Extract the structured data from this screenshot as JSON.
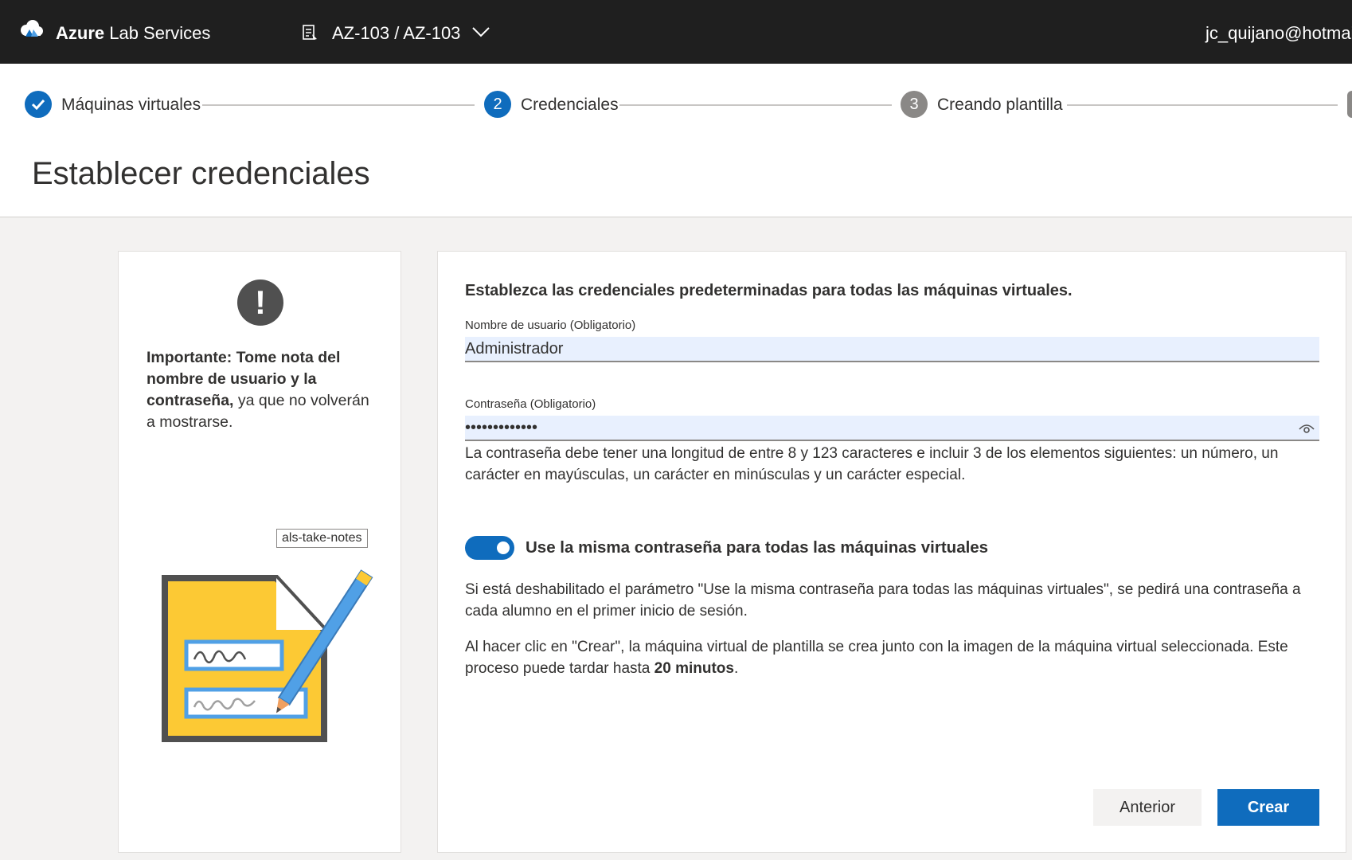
{
  "topbar": {
    "brand_bold": "Azure",
    "brand_rest": " Lab Services",
    "lab_name": "AZ-103 / AZ-103",
    "user_email": "jc_quijano@hotmai"
  },
  "steps": [
    {
      "label": "Máquinas virtuales",
      "state": "done",
      "number": ""
    },
    {
      "label": "Credenciales",
      "state": "active",
      "number": "2"
    },
    {
      "label": "Creando plantilla",
      "state": "pending",
      "number": "3"
    }
  ],
  "page_title": "Establecer credenciales",
  "note": {
    "icon": "!",
    "bold": "Importante: Tome nota del nombre de usuario y la contraseña,",
    "rest": " ya que no volverán a mostrarse.",
    "illustration_tooltip": "als-take-notes"
  },
  "form": {
    "intro": "Establezca las credenciales predeterminadas para todas las máquinas virtuales.",
    "username_label": "Nombre de usuario (Obligatorio)",
    "username_value": "Administrador",
    "password_label": "Contraseña (Obligatorio)",
    "password_value": "•••••••••••••",
    "password_hint": "La contraseña debe tener una longitud de entre 8 y 123 caracteres e incluir 3 de los elementos siguientes: un número, un carácter en mayúsculas, un carácter en minúsculas y un carácter especial.",
    "toggle_on": true,
    "toggle_label": "Use la misma contraseña para todas las máquinas virtuales",
    "toggle_info": "Si está deshabilitado el parámetro \"Use la misma contraseña para todas las máquinas virtuales\", se pedirá una contraseña a cada alumno en el primer inicio de sesión.",
    "create_info_pre": "Al hacer clic en \"Crear\", la máquina virtual de plantilla se crea junto con la imagen de la máquina virtual seleccionada. Este proceso puede tardar hasta ",
    "create_info_bold": "20 minutos",
    "create_info_post": "."
  },
  "buttons": {
    "previous": "Anterior",
    "create": "Crear"
  },
  "colors": {
    "topbar_bg": "#1f1f1f",
    "accent": "#0f6cbd",
    "step_pending": "#8a8886",
    "input_bg": "#e8f0fe"
  }
}
